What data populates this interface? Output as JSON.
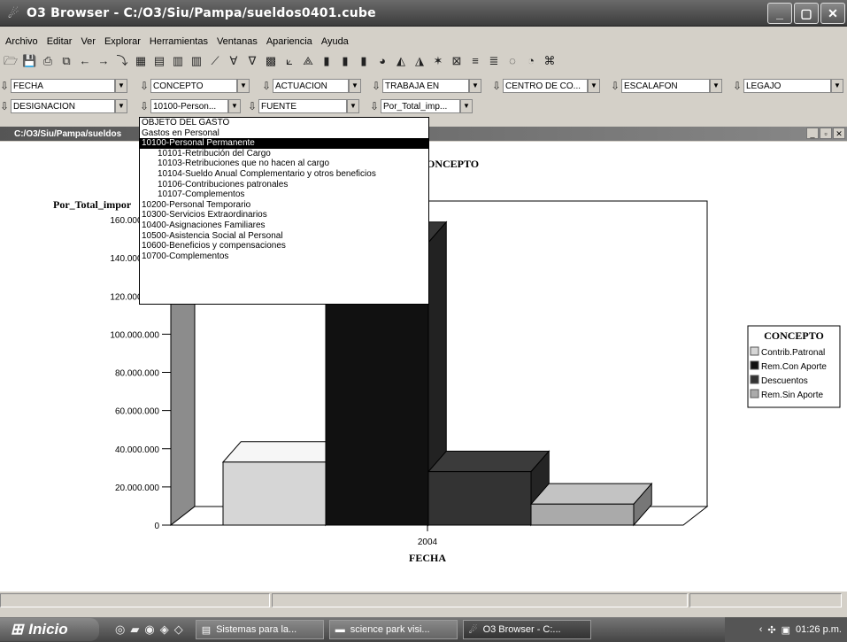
{
  "window": {
    "title": "O3 Browser - C:/O3/Siu/Pampa/sueldos0401.cube",
    "buttons": [
      "_",
      "▢",
      "✕"
    ]
  },
  "menu": [
    "Archivo",
    "Editar",
    "Ver",
    "Explorar",
    "Herramientas",
    "Ventanas",
    "Apariencia",
    "Ayuda"
  ],
  "toolbar_icons": [
    "open-icon",
    "save-icon",
    "print-icon",
    "copy-icon",
    "back-icon",
    "forward-icon",
    "drill-icon",
    "table-icon",
    "pivot-icon",
    "bar-icon",
    "stacked-bar-icon",
    "line-icon",
    "filter-icon",
    "filter2-icon",
    "grid-icon",
    "chart-a-icon",
    "chart-b-icon",
    "bar3d-icon",
    "bar3d2-icon",
    "bar3d3-icon",
    "pie-icon",
    "area-icon",
    "area2-icon",
    "star-icon",
    "xy-icon",
    "hbar-icon",
    "hbar2-icon",
    "donut-icon",
    "pie3d-icon",
    "misc-icon"
  ],
  "dimensions_row1": [
    {
      "label": "FECHA",
      "x": 0,
      "w": 148
    },
    {
      "label": "CONCEPTO",
      "x": 158,
      "w": 128
    },
    {
      "label": "ACTUACION",
      "x": 296,
      "w": 116
    },
    {
      "label": "TRABAJA EN",
      "x": 420,
      "w": 128
    },
    {
      "label": "CENTRO DE CO...",
      "x": 556,
      "w": 126
    },
    {
      "label": "ESCALAFON",
      "x": 690,
      "w": 130
    },
    {
      "label": "LEGAJO",
      "x": 828,
      "w": 129
    }
  ],
  "dimensions_row2": [
    {
      "label": "DESIGNACION",
      "x": 0,
      "w": 148
    },
    {
      "label": "10100-Person...",
      "x": 158,
      "w": 118
    },
    {
      "label": "FUENTE",
      "x": 280,
      "w": 130
    },
    {
      "label": "Por_Total_imp...",
      "x": 418,
      "w": 120
    }
  ],
  "child_window": {
    "title": "C:/O3/Siu/Pampa/sueldos",
    "buttons": [
      "_",
      "▫",
      "✕"
    ]
  },
  "dropdown": {
    "items": [
      {
        "label": "OBJETO DEL GASTO",
        "level": 0,
        "selected": false
      },
      {
        "label": "Gastos en Personal",
        "level": 0,
        "selected": false
      },
      {
        "label": "10100-Personal Permanente",
        "level": 0,
        "selected": true
      },
      {
        "label": "10101-Retribución del Cargo",
        "level": 1,
        "selected": false
      },
      {
        "label": "10103-Retribuciones que no hacen al cargo",
        "level": 1,
        "selected": false
      },
      {
        "label": "10104-Sueldo Anual Complementario y otros beneficios",
        "level": 1,
        "selected": false
      },
      {
        "label": "10106-Contribuciones patronales",
        "level": 1,
        "selected": false
      },
      {
        "label": "10107-Complementos",
        "level": 1,
        "selected": false
      },
      {
        "label": "10200-Personal Temporario",
        "level": 0,
        "selected": false
      },
      {
        "label": "10300-Servicios Extraordinarios",
        "level": 0,
        "selected": false
      },
      {
        "label": "10400-Asignaciones Familiares",
        "level": 0,
        "selected": false
      },
      {
        "label": "10500-Asistencia Social al Personal",
        "level": 0,
        "selected": false
      },
      {
        "label": "10600-Beneficios y compensaciones",
        "level": 0,
        "selected": false
      },
      {
        "label": "10700-Complementos",
        "level": 0,
        "selected": false
      }
    ]
  },
  "chart_data": {
    "type": "bar",
    "title": "ONCEPTO",
    "ylabel": "Por_Total_impor",
    "xlabel": "FECHA",
    "categories": [
      "2004"
    ],
    "ylim": [
      0,
      160000000
    ],
    "yticks": [
      0,
      20000000,
      40000000,
      60000000,
      80000000,
      100000000,
      120000000,
      140000000,
      160000000
    ],
    "ytick_labels": [
      "0",
      "20.000.000",
      "40.000.000",
      "60.000.000",
      "80.000.000",
      "100.000.000",
      "120.000.000",
      "140.000.000",
      "160.000.000"
    ],
    "legend_title": "CONCEPTO",
    "legend_position": "right",
    "series": [
      {
        "name": "Contrib.Patronal",
        "values": [
          33000000
        ],
        "color": "#d6d6d6"
      },
      {
        "name": "Rem.Con Aporte",
        "values": [
          148000000
        ],
        "color": "#111111"
      },
      {
        "name": "Descuentos",
        "values": [
          28000000
        ],
        "color": "#333333"
      },
      {
        "name": "Rem.Sin Aporte",
        "values": [
          11000000
        ],
        "color": "#aaaaaa"
      }
    ]
  },
  "taskbar": {
    "start_label": "Inicio",
    "tasks": [
      "Sistemas para la...",
      "science park visi...",
      "O3 Browser - C:..."
    ],
    "clock": "01:26 p.m."
  }
}
